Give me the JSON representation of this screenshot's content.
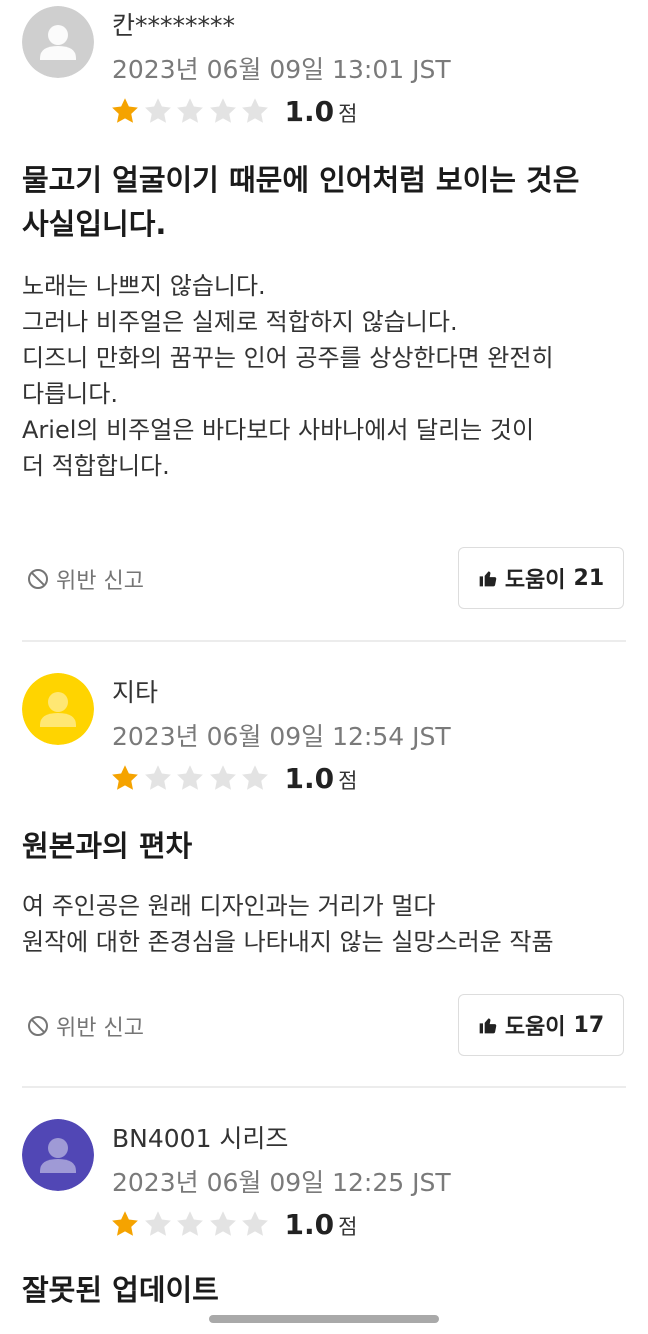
{
  "reviews": [
    {
      "username": "칸********",
      "date": "2023년 06월 09일 13:01 JST",
      "stars_filled": 1,
      "stars_total": 5,
      "score": "1.0",
      "score_unit": "점",
      "title_lines": [
        "물고기 얼굴이기 때문에 인어처럼 보이는 것은",
        "사실입니다."
      ],
      "body_lines": [
        "노래는 나쁘지 않습니다.",
        "그러나 비주얼은 실제로 적합하지 않습니다.",
        "디즈니 만화의 꿈꾸는 인어 공주를 상상한다면 완전히",
        "다릅니다.",
        "Ariel의 비주얼은 바다보다 사바나에서 달리는 것이",
        "더 적합합니다."
      ],
      "report_label": "위반 신고",
      "helpful_label": "도움이",
      "helpful_count": "21",
      "avatar_color": "#cfcfcf"
    },
    {
      "username": "지타",
      "date": "2023년 06월 09일 12:54 JST",
      "stars_filled": 1,
      "stars_total": 5,
      "score": "1.0",
      "score_unit": "점",
      "title_lines": [
        "원본과의 편차"
      ],
      "body_lines": [
        "여 주인공은 원래 디자인과는 거리가 멀다",
        "원작에 대한 존경심을 나타내지 않는 실망스러운 작품"
      ],
      "report_label": "위반 신고",
      "helpful_label": "도움이",
      "helpful_count": "17",
      "avatar_color": "#ffd400"
    },
    {
      "username": "BN4001 시리즈",
      "date": "2023년 06월 09일 12:25 JST",
      "stars_filled": 1,
      "stars_total": 5,
      "score": "1.0",
      "score_unit": "점",
      "title_lines": [
        "잘못된 업데이트"
      ],
      "body_lines": [],
      "avatar_color": "#5147b5"
    }
  ],
  "colors": {
    "star_filled": "#f5a300",
    "star_empty": "#e3e3e3",
    "divider": "#ececec"
  },
  "icons": {
    "report": "prohibited-circle-icon",
    "helpful": "thumbs-up-icon",
    "avatar": "user-silhouette-icon"
  }
}
